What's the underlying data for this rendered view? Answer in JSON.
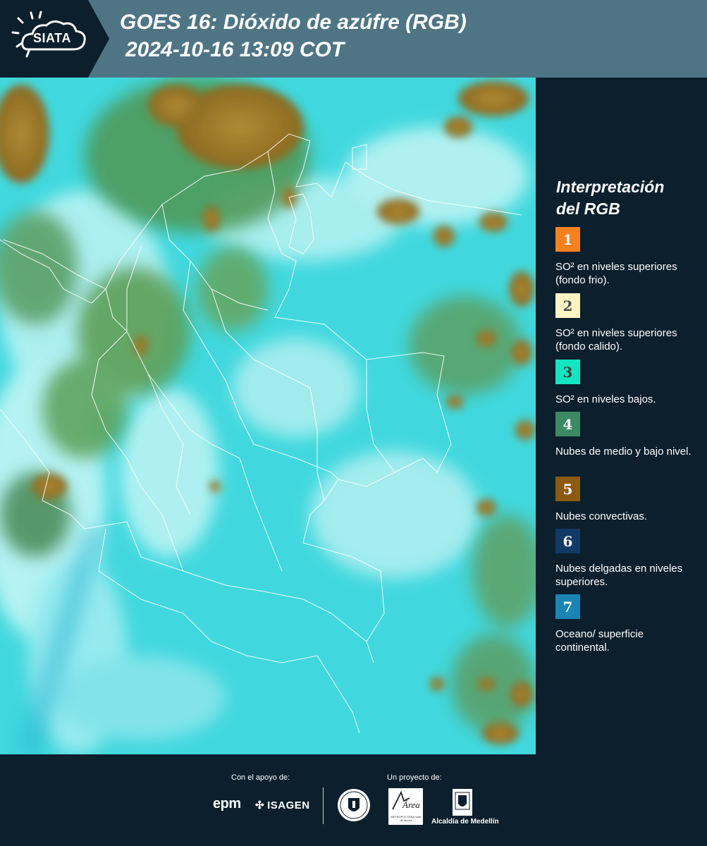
{
  "header": {
    "logo": "SIATA",
    "title_line1": "GOES 16: Dióxido de azúfre (RGB)",
    "title_line2": "2024-10-16 13:09 COT"
  },
  "legend": {
    "title_line1": "Interpretación",
    "title_line2": "del RGB",
    "items": [
      {
        "number": "1",
        "color": "#f5821f",
        "text_color": "#ffffff",
        "description": "SO² en niveles superiores (fondo frio)."
      },
      {
        "number": "2",
        "color": "#fdf4c4",
        "text_color": "#4a4a4a",
        "description": "SO² en niveles superiores (fondo calido)."
      },
      {
        "number": "3",
        "color": "#14e5c1",
        "text_color": "#3a3a3a",
        "description": "SO² en niveles bajos."
      },
      {
        "number": "4",
        "color": "#3b8a63",
        "text_color": "#ffffff",
        "description": "Nubes de medio y bajo nivel."
      },
      {
        "number": "5",
        "color": "#8c5a12",
        "text_color": "#ffffff",
        "description": "Nubes convectivas."
      },
      {
        "number": "6",
        "color": "#123a66",
        "text_color": "#ffffff",
        "description": "Nubes delgadas en niveles superiores."
      },
      {
        "number": "7",
        "color": "#1a84b4",
        "text_color": "#ffffff",
        "description": "Oceano/ superficie continental."
      }
    ]
  },
  "footer": {
    "support_label": "Con el apoyo de:",
    "project_label": "Un proyecto de:",
    "sponsors": [
      "epm",
      "ISAGEN"
    ],
    "area_logo": "Área",
    "area_subtext": "METROPOLITANA Valle de Aburrá",
    "alcaldia": "Alcaldía de Medellín"
  },
  "map": {
    "description_colors": {
      "base": "#3fd6dc",
      "cloud_light": "#c8f6f7",
      "cloud_green": "#3e8b55",
      "convective": "#9a7a2e",
      "borders": "#ffffff"
    }
  }
}
